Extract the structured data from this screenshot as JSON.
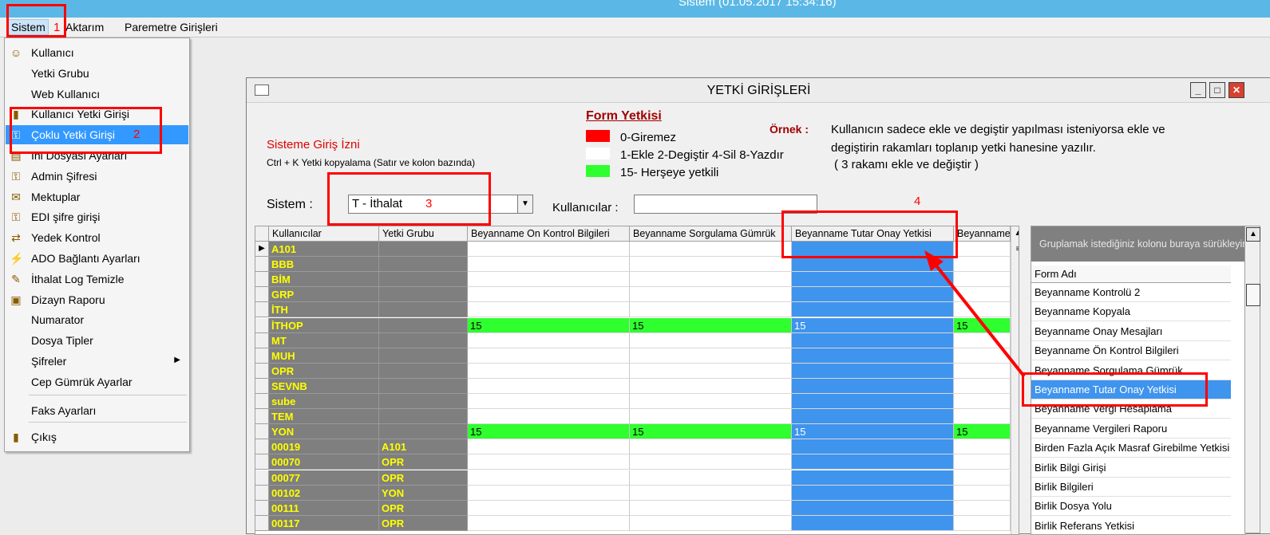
{
  "app": {
    "title": "Sistem (01.05.2017 15:34:16)",
    "menu": [
      "Sistem",
      "Aktarım",
      "Paremetre Girişleri"
    ]
  },
  "dropdown": [
    {
      "label": "Kullanıcı",
      "icon": "user-icon"
    },
    {
      "label": "Yetki Grubu",
      "icon": ""
    },
    {
      "label": "Web Kullanıcı",
      "icon": ""
    },
    {
      "label": "Kullanıcı Yetki Girişi",
      "icon": "door-icon"
    },
    {
      "label": "Çoklu Yetki Girişi",
      "icon": "key-icon",
      "selected": true
    },
    {
      "label": "Ini Dosyası Ayarları",
      "icon": "file-icon"
    },
    {
      "label": "Admin Şifresi",
      "icon": "key-icon"
    },
    {
      "label": "Mektuplar",
      "icon": "mail-icon"
    },
    {
      "label": "EDI şifre girişi",
      "icon": "key-icon"
    },
    {
      "label": "Yedek Kontrol",
      "icon": "backup-icon"
    },
    {
      "label": "ADO Bağlantı Ayarları",
      "icon": "connection-icon"
    },
    {
      "label": "İthalat Log Temizle",
      "icon": "clean-icon"
    },
    {
      "label": "Dizayn Raporu",
      "icon": "report-icon"
    },
    {
      "label": "Numarator",
      "icon": ""
    },
    {
      "label": "Dosya Tipler",
      "icon": ""
    },
    {
      "label": "Şifreler",
      "icon": "",
      "submenu": true
    },
    {
      "label": "Cep Gümrük Ayarlar",
      "icon": ""
    },
    {
      "label": "Faks Ayarları",
      "icon": ""
    },
    {
      "label": "Çıkış",
      "icon": "exit-icon"
    }
  ],
  "window": {
    "title": "YETKİ GİRİŞLERİ",
    "giris_izni": "Sisteme Giriş İzni",
    "copy_hint": "Ctrl + K Yetki kopyalama (Satır ve kolon bazında)",
    "form_yetkisi_title": "Form Yetkisi",
    "legend": [
      {
        "color": "#ff0000",
        "text": "0-Giremez"
      },
      {
        "color": "#ffffff",
        "text": "1-Ekle  2-Degiştir  4-Sil  8-Yazdır"
      },
      {
        "color": "#2fff2f",
        "text": "15- Herşeye yetkili"
      }
    ],
    "ornek_label": "Örnek :",
    "ornek_text": [
      "Kullanıcın sadece ekle ve degiştir yapılması isteniyorsa  ekle ve",
      "degiştirin rakamları toplanıp yetki hanesine yazılır.",
      "( 3 rakamı ekle ve değiştir )"
    ],
    "sistem_label": "Sistem :",
    "sistem_value": "T - İthalat",
    "kullanicilar_label": "Kullanıcılar :",
    "grid_headers": [
      "Kullanıcılar",
      "Yetki Grubu",
      "Beyanname On Kontrol Bilgileri",
      "Beyanname Sorgulama Gümrük",
      "Beyanname Tutar Onay Yetkisi",
      "Beyanname"
    ],
    "rows": [
      {
        "name": "A101",
        "grp": "",
        "vals": [
          "",
          "",
          "",
          ""
        ]
      },
      {
        "name": "BBB",
        "grp": "",
        "vals": [
          "",
          "",
          "",
          ""
        ]
      },
      {
        "name": "BİM",
        "grp": "",
        "vals": [
          "",
          "",
          "",
          ""
        ]
      },
      {
        "name": "GRP",
        "grp": "",
        "vals": [
          "",
          "",
          "",
          ""
        ]
      },
      {
        "name": "İTH",
        "grp": "",
        "vals": [
          "",
          "",
          "",
          ""
        ]
      },
      {
        "name": "İTHOP",
        "grp": "",
        "vals": [
          "15",
          "15",
          "15",
          "15"
        ]
      },
      {
        "name": "MT",
        "grp": "",
        "vals": [
          "",
          "",
          "",
          ""
        ]
      },
      {
        "name": "MUH",
        "grp": "",
        "vals": [
          "",
          "",
          "",
          ""
        ]
      },
      {
        "name": "OPR",
        "grp": "",
        "vals": [
          "",
          "",
          "",
          ""
        ]
      },
      {
        "name": "SEVNB",
        "grp": "",
        "vals": [
          "",
          "",
          "",
          ""
        ]
      },
      {
        "name": "sube",
        "grp": "",
        "vals": [
          "",
          "",
          "",
          ""
        ]
      },
      {
        "name": "TEM",
        "grp": "",
        "vals": [
          "",
          "",
          "",
          ""
        ]
      },
      {
        "name": "YON",
        "grp": "",
        "vals": [
          "15",
          "15",
          "15",
          "15"
        ]
      },
      {
        "name": "00019",
        "grp": "A101",
        "vals": [
          "",
          "",
          "",
          ""
        ]
      },
      {
        "name": "00070",
        "grp": "OPR",
        "vals": [
          "",
          "",
          "",
          ""
        ]
      },
      {
        "name": "00077",
        "grp": "OPR",
        "vals": [
          "",
          "",
          "",
          ""
        ]
      },
      {
        "name": "00102",
        "grp": "YON",
        "vals": [
          "",
          "",
          "",
          ""
        ]
      },
      {
        "name": "00111",
        "grp": "OPR",
        "vals": [
          "",
          "",
          "",
          ""
        ]
      },
      {
        "name": "00117",
        "grp": "OPR",
        "vals": [
          "",
          "",
          "",
          ""
        ]
      }
    ],
    "group_hint": "Gruplamak istediğiniz kolonu buraya sürükleyin",
    "form_adi_header": "Form Adı",
    "form_list": [
      "Beyanname Kontrolü 2",
      "Beyanname Kopyala",
      "Beyanname Onay Mesajları",
      "Beyanname Ön Kontrol Bilgileri",
      "Beyanname Sorgulama Gümrük",
      "Beyanname Tutar Onay Yetkisi",
      "Beyanname Vergi Hesaplama",
      "Beyanname Vergileri Raporu",
      "Birden Fazla Açık Masraf Girebilme Yetkisi",
      "Birlik Bilgi Girişi",
      "Birlik Bilgileri",
      "Birlik Dosya Yolu",
      "Birlik Referans Yetkisi"
    ],
    "form_list_selected": 5
  },
  "annotations": [
    "1",
    "2",
    "3",
    "4"
  ]
}
